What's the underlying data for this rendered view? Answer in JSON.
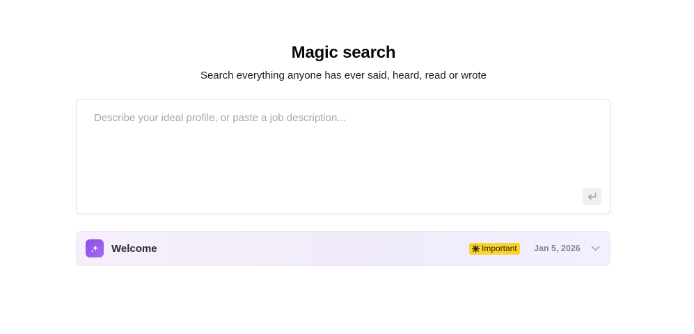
{
  "header": {
    "title": "Magic search",
    "subtitle": "Search everything anyone has ever said, heard, read or wrote"
  },
  "search": {
    "placeholder": "Describe your ideal profile, or paste a job description...",
    "value": "",
    "submit_icon": "enter-return-icon"
  },
  "card": {
    "icon": "sparkles-icon",
    "title": "Welcome",
    "badge": {
      "icon": "asterisk-icon",
      "label": "Important",
      "color": "#fcd22e"
    },
    "date": "Jan 5, 2026",
    "expand_icon": "chevron-down-icon"
  },
  "colors": {
    "accent_purple": "#8b4dea",
    "badge_yellow": "#fcd22e",
    "card_background": "#f4eefa"
  }
}
